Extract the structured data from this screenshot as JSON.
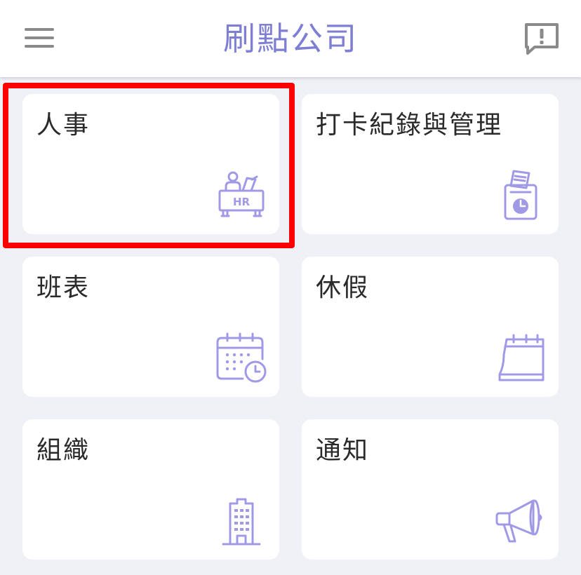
{
  "header": {
    "title": "刷點公司"
  },
  "colors": {
    "accent": "#7d7ed4",
    "icon": "#a09ae6",
    "background": "#f0f0f7",
    "highlight": "#ff0000"
  },
  "tiles": [
    {
      "label": "人事",
      "icon": "hr-desk-icon"
    },
    {
      "label": "打卡紀錄與管理",
      "icon": "time-clock-icon"
    },
    {
      "label": "班表",
      "icon": "calendar-clock-icon"
    },
    {
      "label": "休假",
      "icon": "calendar-icon"
    },
    {
      "label": "組織",
      "icon": "building-icon"
    },
    {
      "label": "通知",
      "icon": "megaphone-icon"
    }
  ]
}
